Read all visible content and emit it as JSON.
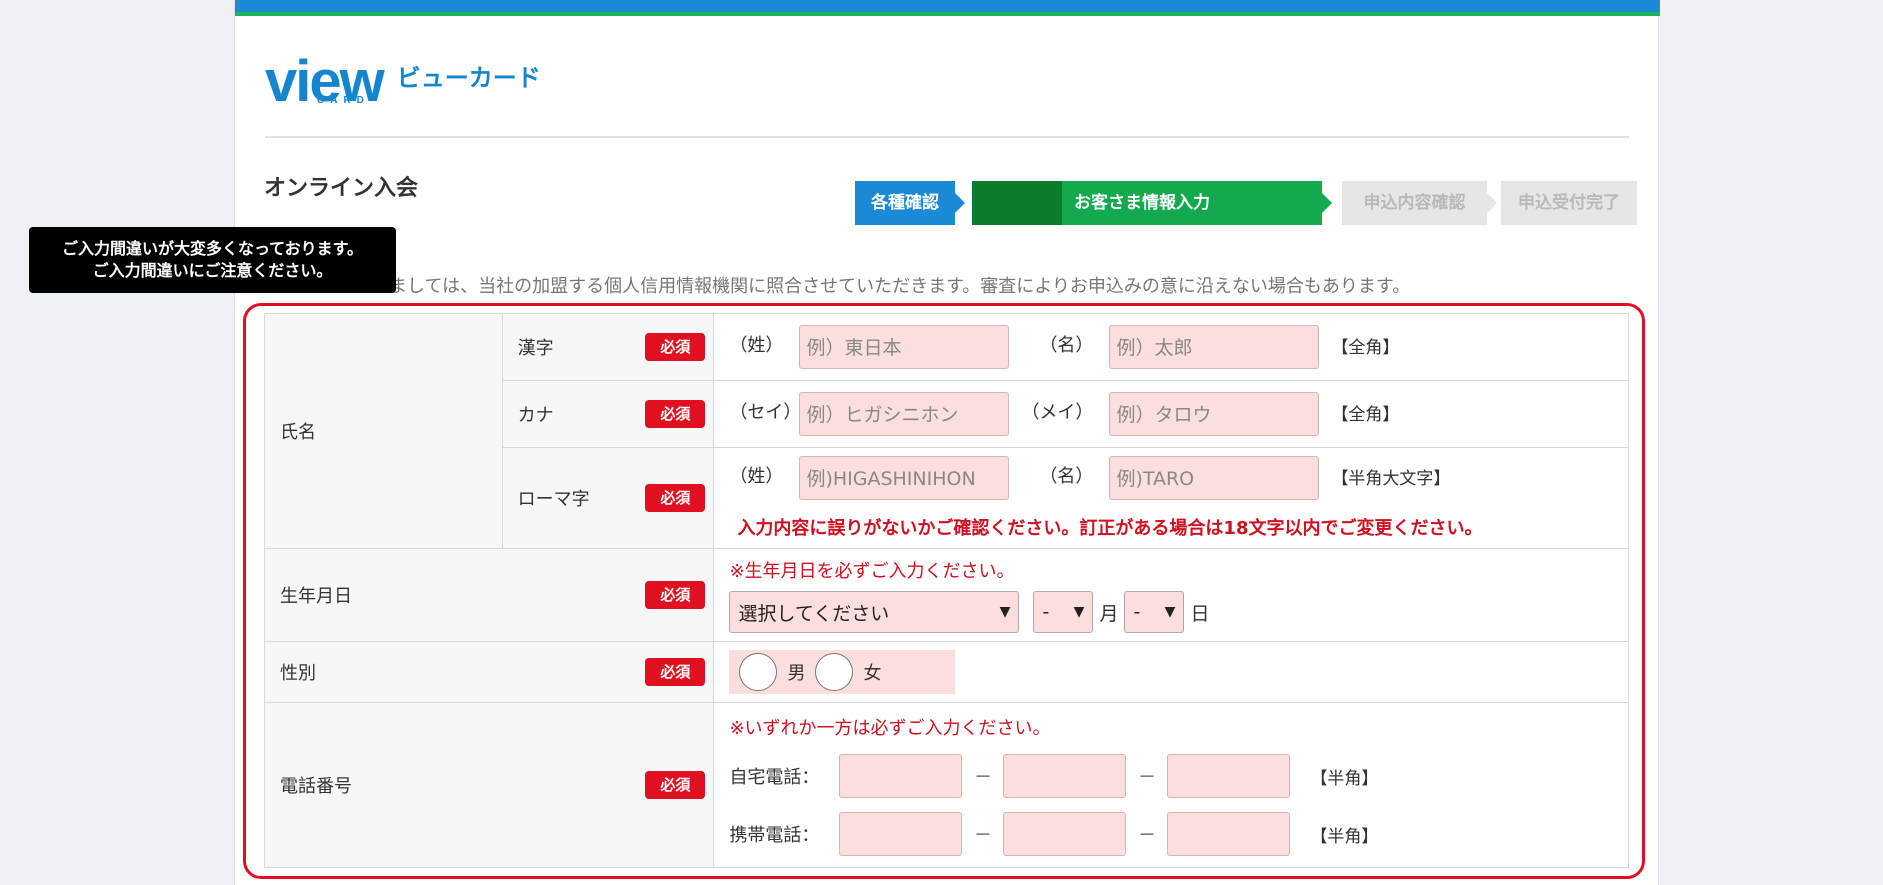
{
  "brand": {
    "logo_text": "view",
    "logo_sub": "CARD",
    "logo_kana": "ビューカード"
  },
  "page": {
    "title": "オンライン入会"
  },
  "steps": [
    {
      "label": "各種確認"
    },
    {
      "label": "お客さま情報入力"
    },
    {
      "label": "申込内容確認"
    },
    {
      "label": "申込受付完了"
    }
  ],
  "notice": "ましては、当社の加盟する個人信用情報機関に照合させていただきます。審査によりお申込みの意に沿えない場合もあります。",
  "tooltip": {
    "line1": "ご入力間違いが大変多くなっております。",
    "line2": "ご入力間違いにご注意ください。"
  },
  "required_badge": "必須",
  "name": {
    "label": "氏名",
    "kanji": {
      "label": "漢字",
      "prefix_last": "（姓）",
      "last_placeholder": "例）東日本",
      "prefix_first": "（名）",
      "first_placeholder": "例）太郎",
      "hint": "【全角】"
    },
    "kana": {
      "label": "カナ",
      "prefix_last": "（セイ）",
      "last_placeholder": "例）ヒガシニホン",
      "prefix_first": "（メイ）",
      "first_placeholder": "例）タロウ",
      "hint": "【全角】"
    },
    "roman": {
      "label": "ローマ字",
      "prefix_last": "（姓）",
      "last_placeholder": "例)HIGASHINIHON",
      "prefix_first": "（名）",
      "first_placeholder": "例)TARO",
      "hint": "【半角大文字】",
      "error": "入力内容に誤りがないかご確認ください。訂正がある場合は18文字以内でご変更ください。"
    }
  },
  "birth": {
    "label": "生年月日",
    "error": "※生年月日を必ずご入力ください。",
    "year_value": "選択してください",
    "month_value": "-",
    "month_unit": "月",
    "day_value": "-",
    "day_unit": "日"
  },
  "gender": {
    "label": "性別",
    "male": "男",
    "female": "女"
  },
  "phone": {
    "label": "電話番号",
    "error": "※いずれか一方は必ずご入力ください。",
    "home_label": "自宅電話：",
    "mobile_label": "携帯電話：",
    "dash": "－",
    "hint": "【半角】"
  },
  "colors": {
    "brand_blue": "#1a8ad6",
    "step_green": "#12a94f",
    "required_red": "#e01020",
    "input_pink": "#fddede"
  }
}
